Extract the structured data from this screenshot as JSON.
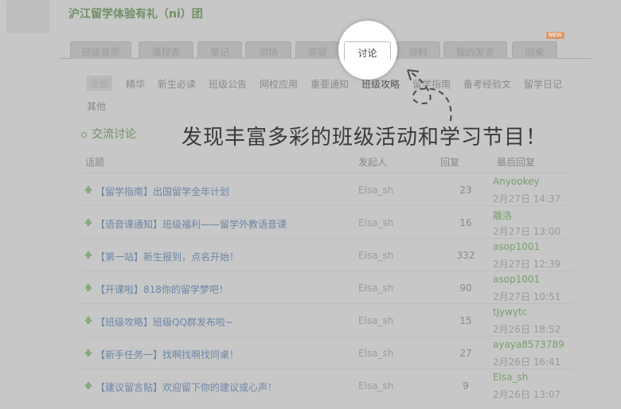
{
  "header": {
    "title": "沪江留学体验有礼（ni）团"
  },
  "tabs": [
    {
      "label": "班级首页"
    },
    {
      "label": "课程表"
    },
    {
      "label": "笔记"
    },
    {
      "label": "词场"
    },
    {
      "label": "答疑"
    },
    {
      "label": "讨论",
      "active": true
    },
    {
      "label": "资料"
    },
    {
      "label": "我的发言"
    },
    {
      "label": "同桌",
      "badge": "NEW"
    }
  ],
  "categories": [
    "全部",
    "精华",
    "新生必读",
    "班级公告",
    "网校应用",
    "重要通知",
    "班级攻略",
    "留学指南",
    "备考经验文",
    "留学日记",
    "其他"
  ],
  "section": {
    "title": "交流讨论"
  },
  "headline": "发现丰富多彩的班级活动和学习节目！",
  "table": {
    "headers": {
      "topic": "话题",
      "starter": "发起人",
      "replies": "回复",
      "last": "最后回复"
    },
    "rows": [
      {
        "tag": "【留学指南】",
        "title": "出国留学全年计划",
        "starter": "Elsa_sh",
        "replies": "23",
        "last_user": "Anyookey",
        "last_time": "2月27日 14:37"
      },
      {
        "tag": "【语音课通知】",
        "title": "班级福利——留学外教语音课",
        "starter": "Elsa_sh",
        "replies": "16",
        "last_user": "離洛",
        "last_time": "2月27日 13:00"
      },
      {
        "tag": "【第一站】",
        "title": "新生报到，点名开始！",
        "starter": "Elsa_sh",
        "replies": "332",
        "last_user": "asop1001",
        "last_time": "2月27日 12:39"
      },
      {
        "tag": "【开课啦】",
        "title": "818你的留学梦吧！",
        "starter": "Elsa_sh",
        "replies": "90",
        "last_user": "asop1001",
        "last_time": "2月27日 10:51"
      },
      {
        "tag": "【班级攻略】",
        "title": "班级QQ群发布啦~",
        "starter": "Elsa_sh",
        "replies": "15",
        "last_user": "tjywytc",
        "last_time": "2月26日 18:52"
      },
      {
        "tag": "【新手任务一】",
        "title": "找啊找啊找同桌！",
        "starter": "Elsa_sh",
        "replies": "27",
        "last_user": "ayaya8573789",
        "last_time": "2月26日 16:41"
      },
      {
        "tag": "【建议留言贴】",
        "title": "欢迎留下你的建议或心声！",
        "starter": "Elsa_sh",
        "replies": "9",
        "last_user": "Elsa_sh",
        "last_time": "2月26日 13:07"
      }
    ]
  }
}
